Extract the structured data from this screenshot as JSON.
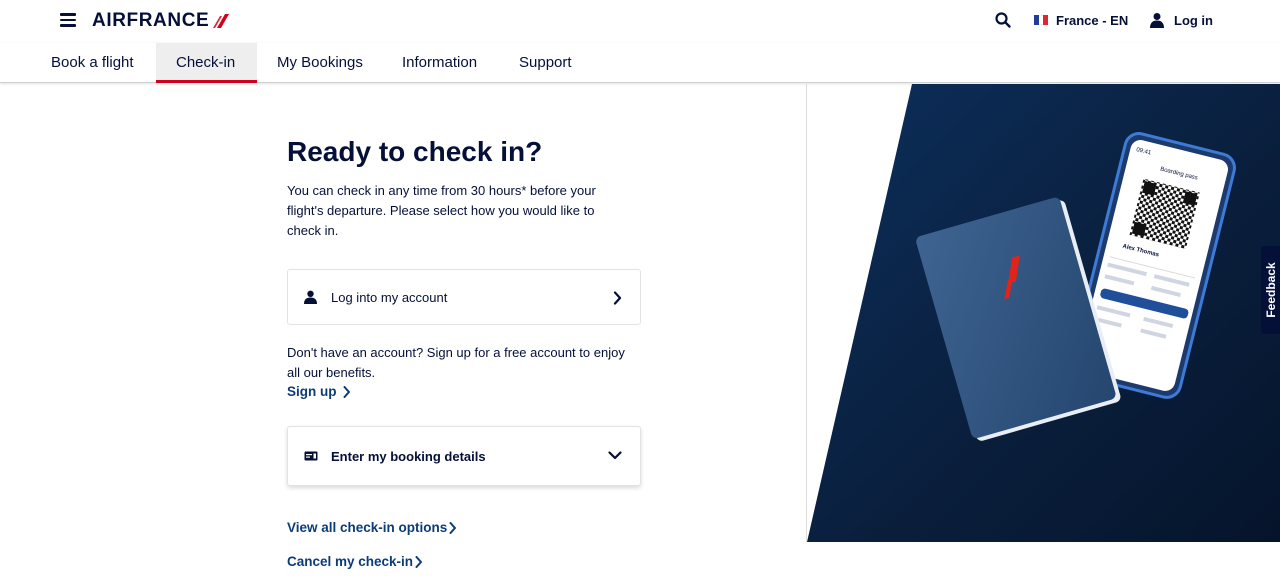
{
  "header": {
    "brand": "AIRFRANCE",
    "language": "France - EN",
    "login_label": "Log in"
  },
  "nav": {
    "items": [
      {
        "label": "Book a flight"
      },
      {
        "label": "Check-in",
        "active": true
      },
      {
        "label": "My Bookings"
      },
      {
        "label": "Information"
      },
      {
        "label": "Support"
      }
    ]
  },
  "main": {
    "title": "Ready to check in?",
    "intro": "You can check in any time from 30 hours* before your flight's departure. Please select how you would like to check in.",
    "login_option": {
      "label": "Log into my account",
      "icon": "user-icon"
    },
    "signup_text": "Don't have an account? Sign up for a free account to enjoy all our benefits.",
    "signup_link": "Sign up",
    "booking_option": {
      "label": "Enter my booking details",
      "icon": "ticket-icon"
    },
    "view_options_link": "View all check-in options",
    "cancel_link": "Cancel my check-in"
  },
  "hero": {
    "phone_time": "09:41",
    "phone_title": "Boarding pass",
    "passenger_name": "Alex Thomas"
  },
  "feedback_label": "Feedback",
  "colors": {
    "navy": "#051039",
    "brand_red": "#d0021b",
    "link_blue": "#0b3c7a",
    "hero_dark": "#0a1f3d"
  }
}
